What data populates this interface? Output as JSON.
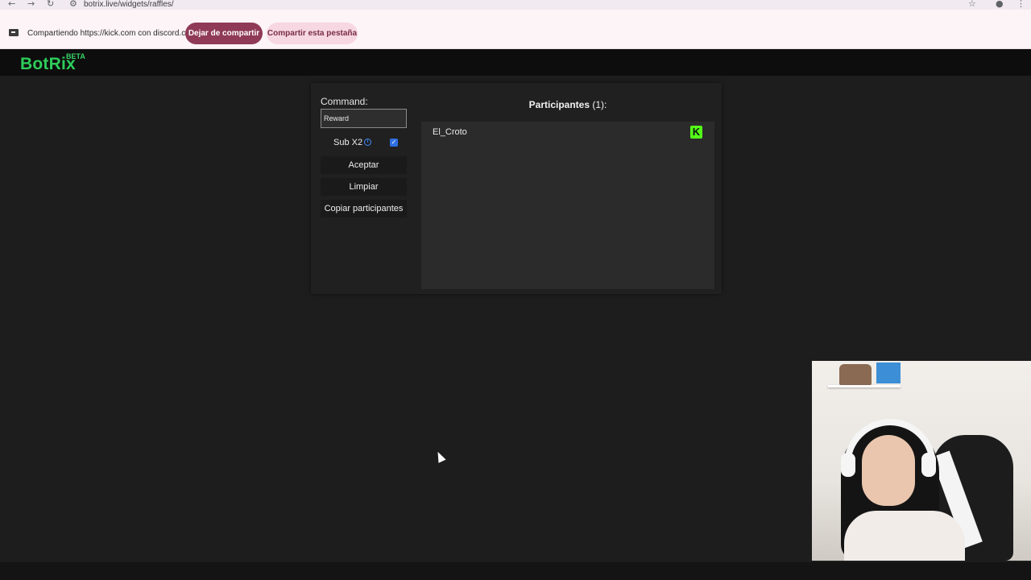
{
  "browser": {
    "url": "botrix.live/widgets/raffles/"
  },
  "sharing": {
    "message": "Compartiendo https://kick.com con discord.com",
    "stop_label": "Dejar de compartir",
    "share_tab_label": "Compartir esta pestaña"
  },
  "app": {
    "logo": "BotRix",
    "badge": "BETA"
  },
  "raffle": {
    "command_label": "Command:",
    "command_value": "Reward",
    "sub_label": "Sub X2",
    "sub_checked": true,
    "buttons": {
      "accept": "Aceptar",
      "clear": "Limpiar",
      "copy": "Copiar participantes"
    },
    "participants_title": "Participantes",
    "participants_count": "(1):",
    "participants": [
      {
        "name": "El_Croto",
        "platform_icon": "kick-icon"
      }
    ]
  },
  "colors": {
    "brand_green": "#2ecc5b",
    "kick_green": "#53fc18",
    "share_stop": "#8f3a56"
  }
}
